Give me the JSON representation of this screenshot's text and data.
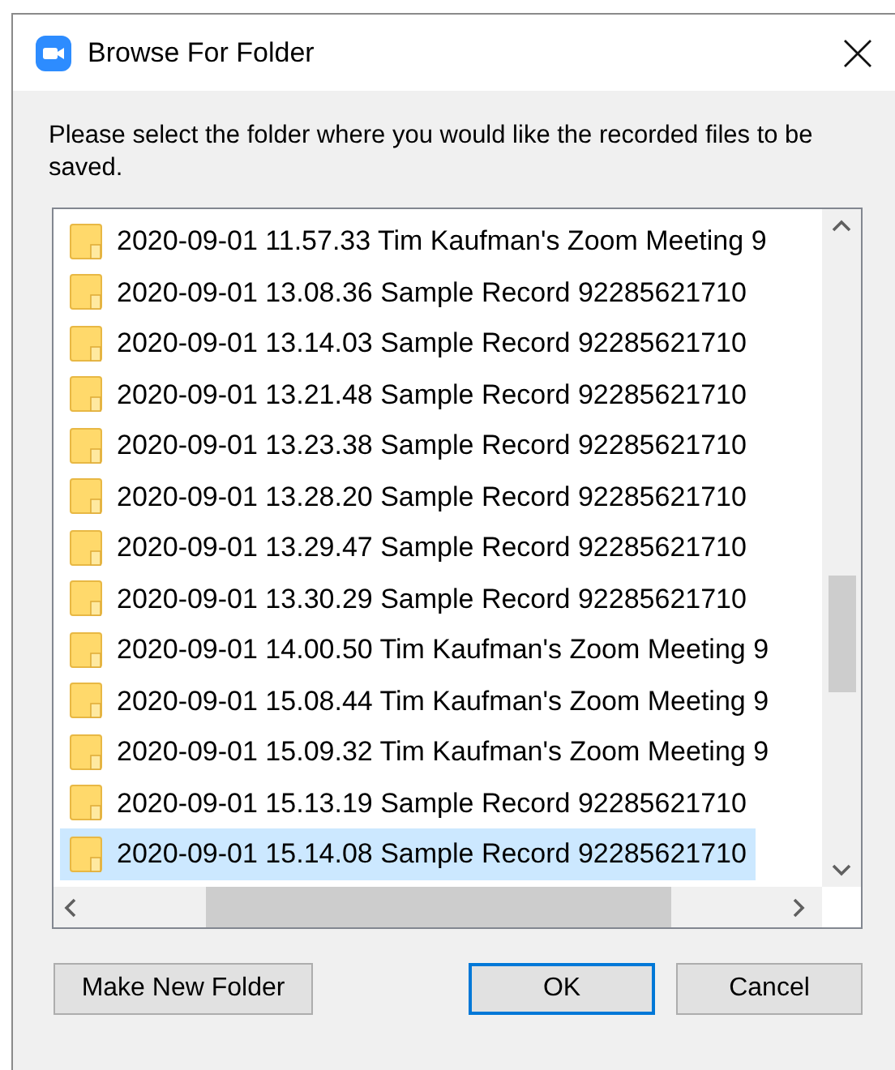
{
  "window": {
    "title": "Browse For Folder"
  },
  "prompt": "Please select the folder where you would like the recorded files to be saved.",
  "folders": [
    {
      "name": "2020-09-01 11.57.33 Tim Kaufman's Zoom Meeting 9",
      "selected": false
    },
    {
      "name": "2020-09-01 13.08.36 Sample Record 92285621710",
      "selected": false
    },
    {
      "name": "2020-09-01 13.14.03 Sample Record 92285621710",
      "selected": false
    },
    {
      "name": "2020-09-01 13.21.48 Sample Record 92285621710",
      "selected": false
    },
    {
      "name": "2020-09-01 13.23.38 Sample Record 92285621710",
      "selected": false
    },
    {
      "name": "2020-09-01 13.28.20 Sample Record 92285621710",
      "selected": false
    },
    {
      "name": "2020-09-01 13.29.47 Sample Record 92285621710",
      "selected": false
    },
    {
      "name": "2020-09-01 13.30.29 Sample Record 92285621710",
      "selected": false
    },
    {
      "name": "2020-09-01 14.00.50 Tim Kaufman's Zoom Meeting 9",
      "selected": false
    },
    {
      "name": "2020-09-01 15.08.44 Tim Kaufman's Zoom Meeting 9",
      "selected": false
    },
    {
      "name": "2020-09-01 15.09.32 Tim Kaufman's Zoom Meeting 9",
      "selected": false
    },
    {
      "name": "2020-09-01 15.13.19 Sample Record 92285621710",
      "selected": false
    },
    {
      "name": "2020-09-01 15.14.08 Sample Record 92285621710",
      "selected": true
    }
  ],
  "buttons": [
    {
      "label": "Make New Folder",
      "default": false
    },
    {
      "label": "OK",
      "default": true
    },
    {
      "label": "Cancel",
      "default": false
    }
  ]
}
